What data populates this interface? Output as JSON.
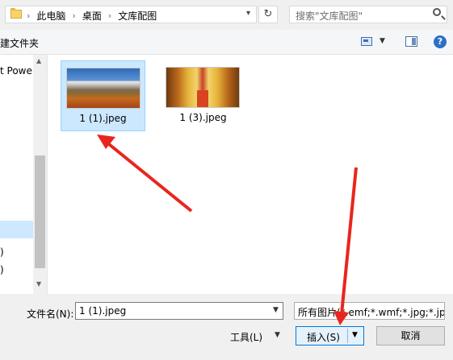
{
  "breadcrumb": {
    "items": [
      "此电脑",
      "桌面",
      "文库配图"
    ]
  },
  "search": {
    "placeholder": "搜索\"文库配图\""
  },
  "toolbar": {
    "new_folder": "建文件夹",
    "help": "?"
  },
  "nav": {
    "items": [
      "t Power"
    ]
  },
  "files": [
    {
      "name": "1 (1).jpeg",
      "selected": true
    },
    {
      "name": "1 (3).jpeg",
      "selected": false
    }
  ],
  "footer": {
    "filename_label": "文件名(N):",
    "filename_value": "1 (1).jpeg",
    "filter": "所有图片(*.emf;*.wmf;*.jpg;*.jp",
    "tools": "工具(L)",
    "insert": "插入(S)",
    "cancel": "取消"
  },
  "colors": {
    "accent": "#0078d7",
    "selection": "#cce8ff",
    "annotation": "#e8261f"
  },
  "icons": [
    "folder-icon",
    "chevron-right-icon",
    "chevron-down-icon",
    "refresh-icon",
    "search-icon",
    "view-icon",
    "preview-pane-icon",
    "help-icon"
  ]
}
